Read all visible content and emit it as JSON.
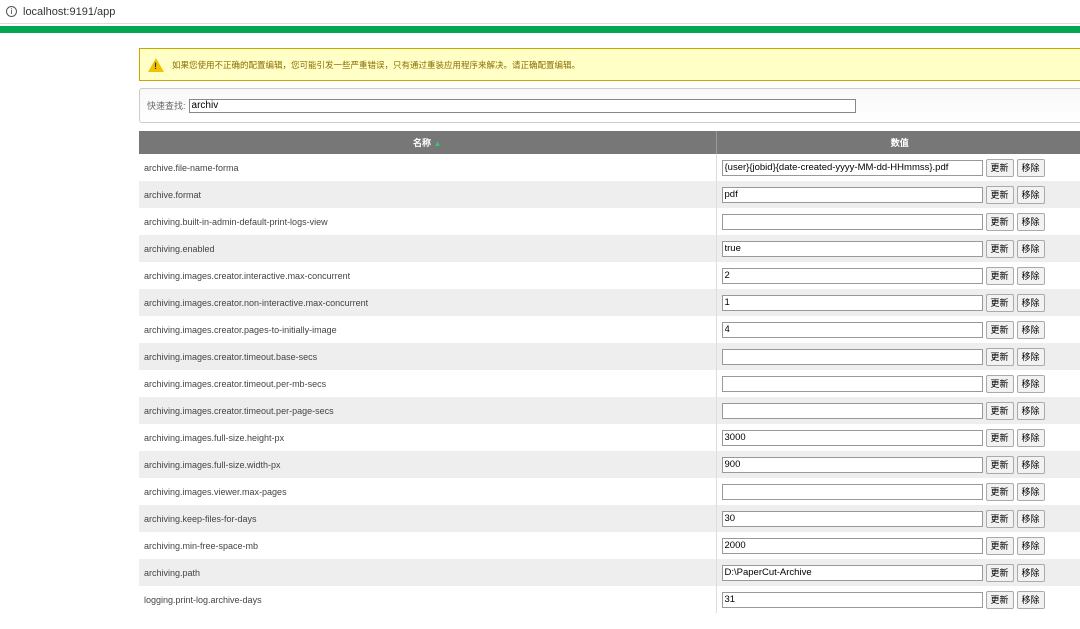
{
  "browser": {
    "url": "localhost:9191/app"
  },
  "warning": "如果您使用不正确的配置编辑，您可能引发一些严重错误，只有通过重装应用程序来解决。请正确配置编辑。",
  "search": {
    "label": "快速查找:",
    "value": "archiv"
  },
  "table": {
    "headers": {
      "name": "名称",
      "value": "数值"
    },
    "sort_indicator": "▲",
    "update_label": "更新",
    "remove_label": "移除",
    "rows": [
      {
        "name": "archive.file-name-forma",
        "value": "{user}{jobid}{date-created-yyyy-MM-dd-HHmmss}.pdf"
      },
      {
        "name": "archive.format",
        "value": "pdf"
      },
      {
        "name": "archiving.built-in-admin-default-print-logs-view",
        "value": ""
      },
      {
        "name": "archiving.enabled",
        "value": "true"
      },
      {
        "name": "archiving.images.creator.interactive.max-concurrent",
        "value": "2"
      },
      {
        "name": "archiving.images.creator.non-interactive.max-concurrent",
        "value": "1"
      },
      {
        "name": "archiving.images.creator.pages-to-initially-image",
        "value": "4"
      },
      {
        "name": "archiving.images.creator.timeout.base-secs",
        "value": ""
      },
      {
        "name": "archiving.images.creator.timeout.per-mb-secs",
        "value": ""
      },
      {
        "name": "archiving.images.creator.timeout.per-page-secs",
        "value": ""
      },
      {
        "name": "archiving.images.full-size.height-px",
        "value": "3000"
      },
      {
        "name": "archiving.images.full-size.width-px",
        "value": "900"
      },
      {
        "name": "archiving.images.viewer.max-pages",
        "value": ""
      },
      {
        "name": "archiving.keep-files-for-days",
        "value": "30"
      },
      {
        "name": "archiving.min-free-space-mb",
        "value": "2000"
      },
      {
        "name": "archiving.path",
        "value": "D:\\PaperCut-Archive"
      },
      {
        "name": "logging.print-log.archive-days",
        "value": "31"
      }
    ]
  }
}
